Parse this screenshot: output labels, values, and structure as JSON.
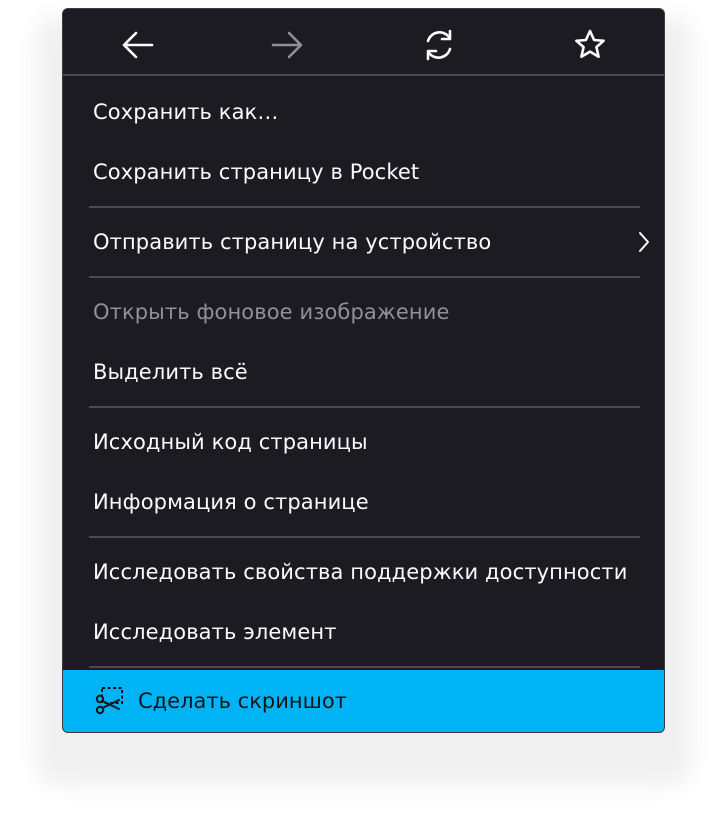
{
  "nav": {
    "back_icon": "arrow-left-icon",
    "forward_icon": "arrow-right-icon",
    "reload_icon": "reload-icon",
    "bookmark_icon": "star-icon"
  },
  "menu": {
    "save_as": "Сохранить как…",
    "save_to_pocket": "Сохранить страницу в Pocket",
    "send_to_device": "Отправить страницу на устройство",
    "open_background": "Открыть фоновое изображение",
    "select_all": "Выделить всё",
    "view_source": "Исходный код страницы",
    "page_info": "Информация о странице",
    "inspect_accessibility": "Исследовать свойства поддержки доступности",
    "inspect_element": "Исследовать элемент",
    "take_screenshot": "Сделать скриншот"
  },
  "colors": {
    "menu_bg": "#1c1b22",
    "text": "#fbfbfe",
    "disabled_text": "#8f8f9d",
    "separator": "#4a4950",
    "highlight": "#00b3f4"
  }
}
